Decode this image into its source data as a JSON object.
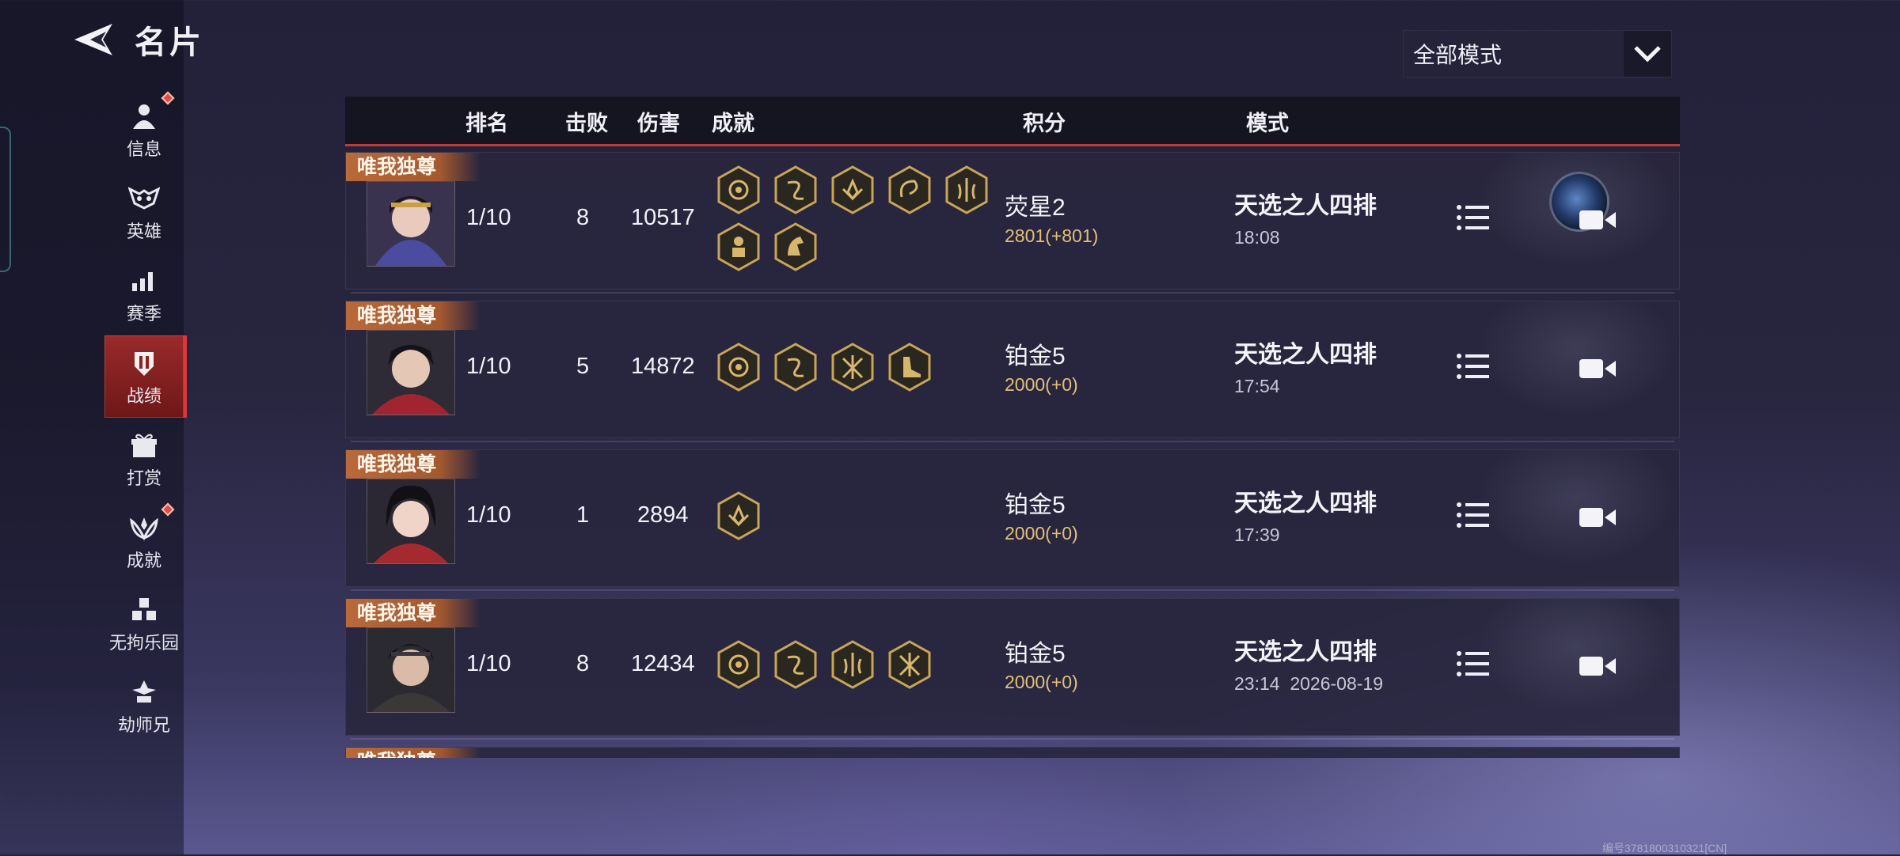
{
  "header": {
    "title": "名片"
  },
  "sidebar": {
    "items": [
      {
        "label": "信息",
        "icon": "person-icon",
        "badge": true
      },
      {
        "label": "英雄",
        "icon": "mask-icon",
        "badge": false
      },
      {
        "label": "赛季",
        "icon": "bar-chart-icon",
        "badge": false
      },
      {
        "label": "战绩",
        "icon": "shield-icon",
        "badge": false,
        "active": true
      },
      {
        "label": "打赏",
        "icon": "gift-icon",
        "badge": false
      },
      {
        "label": "成就",
        "icon": "laurel-icon",
        "badge": true
      },
      {
        "label": "无拘乐园",
        "icon": "cubes-icon",
        "badge": false
      },
      {
        "label": "劫师兄",
        "icon": "hat-icon",
        "badge": false
      }
    ]
  },
  "mode_filter": {
    "selected": "全部模式"
  },
  "table": {
    "headers": {
      "rank": "排名",
      "kills": "击败",
      "damage": "伤害",
      "achievements": "成就",
      "score": "积分",
      "mode": "模式"
    },
    "rows": [
      {
        "ribbon": "唯我独尊",
        "rank": "1/10",
        "kills": "8",
        "damage": "10517",
        "achievement_count": 7,
        "score_tier": "荧星2",
        "score_value": "2801(+801)",
        "mode": "天选之人四排",
        "time": "18:08"
      },
      {
        "ribbon": "唯我独尊",
        "rank": "1/10",
        "kills": "5",
        "damage": "14872",
        "achievement_count": 4,
        "score_tier": "铂金5",
        "score_value": "2000(+0)",
        "mode": "天选之人四排",
        "time": "17:54"
      },
      {
        "ribbon": "唯我独尊",
        "rank": "1/10",
        "kills": "1",
        "damage": "2894",
        "achievement_count": 1,
        "score_tier": "铂金5",
        "score_value": "2000(+0)",
        "mode": "天选之人四排",
        "time": "17:39"
      },
      {
        "ribbon": "唯我独尊",
        "rank": "1/10",
        "kills": "8",
        "damage": "12434",
        "achievement_count": 4,
        "score_tier": "铂金5",
        "score_value": "2000(+0)",
        "mode": "天选之人四排",
        "time": "23:14  2026-08-19"
      },
      {
        "ribbon": "唯我独尊"
      }
    ]
  },
  "footer": {
    "code": "编号3781800310321[CN]"
  },
  "colors": {
    "accent_red": "#b2413e",
    "ribbon": "#b86a3b",
    "score_gold": "#e2c07a",
    "active_nav": "#8a2222"
  }
}
